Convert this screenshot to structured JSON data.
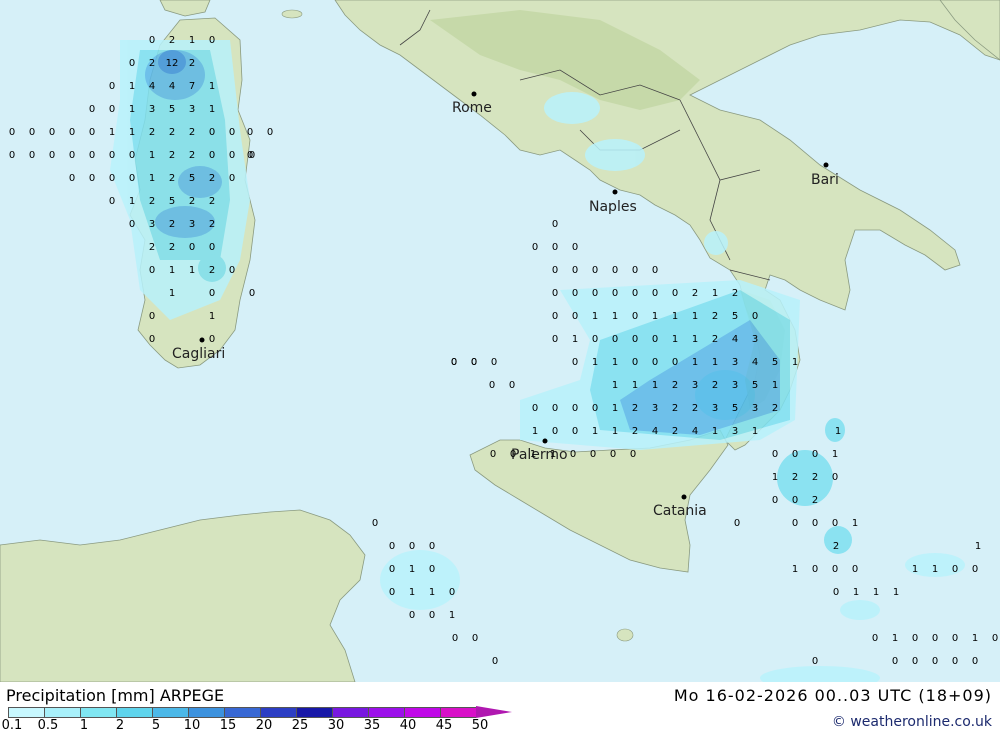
{
  "title": "Precipitation [mm] ARPEGE",
  "datetime": "Mo 16-02-2026 00..03 UTC (18+09)",
  "credit": "© weatheronline.co.uk",
  "legend": {
    "labels": [
      "0.1",
      "0.5",
      "1",
      "2",
      "5",
      "10",
      "15",
      "20",
      "25",
      "30",
      "35",
      "40",
      "45",
      "50"
    ],
    "colors": [
      "#c8f8ff",
      "#a8f0fa",
      "#80e6f2",
      "#5fd4ec",
      "#4cb8e8",
      "#3d92de",
      "#3868d4",
      "#2c3ec4",
      "#1818a8",
      "#7818e0",
      "#9c10ea",
      "#c008e8",
      "#d810c8",
      "#b018b0"
    ]
  },
  "colors": {
    "sea": "#d6f0f8",
    "land": "#d8e6c2",
    "land_hill": "#c3d7a7",
    "precip_light": "#b8f2fb",
    "precip_mid": "#7ee0f0",
    "precip_high": "#5cb8e8"
  },
  "cities": [
    {
      "name": "Rome"
    },
    {
      "name": "Naples"
    },
    {
      "name": "Bari"
    },
    {
      "name": "Cagliari"
    },
    {
      "name": "Palermo"
    },
    {
      "name": "Catania"
    }
  ],
  "values": [
    [
      "0",
      "2",
      "1",
      "0"
    ],
    [
      "0",
      "2",
      "12",
      "2"
    ],
    [
      "0",
      "1",
      "4",
      "4",
      "7",
      "1"
    ],
    [
      "0",
      "0",
      "1",
      "3",
      "5",
      "3",
      "1"
    ],
    [
      "0",
      "0",
      "0",
      "0",
      "0",
      "1",
      "1",
      "2",
      "2",
      "2",
      "0",
      "0"
    ],
    [
      "0",
      "0",
      "0",
      "0",
      "0",
      "0",
      "0",
      "1",
      "2",
      "2",
      "0",
      "0",
      "0"
    ],
    [
      "0",
      "0",
      "0",
      "0",
      "1",
      "2",
      "5",
      "2",
      "0"
    ],
    [
      "0",
      "1",
      "2",
      "5",
      "2",
      "2"
    ],
    [
      "0",
      "3",
      "2",
      "3",
      "2"
    ],
    [
      "2",
      "2",
      "0",
      "0"
    ],
    [
      "0",
      "1",
      "1",
      "2",
      "0"
    ],
    [
      "1",
      "0",
      "0"
    ],
    [
      "0",
      "1"
    ],
    [
      "0",
      "0"
    ],
    [
      "0",
      "0",
      "0"
    ],
    [
      "0",
      "0"
    ],
    [
      "0"
    ],
    [
      "0",
      "0",
      "0"
    ],
    [
      "0",
      "0",
      "0",
      "0"
    ],
    [
      "0",
      "0",
      "0",
      "0",
      "0",
      "0",
      "0",
      "2",
      "1",
      "2"
    ],
    [
      "0",
      "0",
      "1",
      "1",
      "0",
      "1",
      "1",
      "1",
      "2",
      "5",
      "0"
    ],
    [
      "0",
      "1",
      "0",
      "0",
      "0",
      "0",
      "1",
      "1",
      "2",
      "4",
      "3"
    ],
    [
      "0",
      "1",
      "1",
      "0",
      "0",
      "0",
      "1",
      "1",
      "3",
      "4",
      "5",
      "1"
    ],
    [
      "0",
      "0"
    ],
    [
      "1",
      "1",
      "1",
      "2",
      "3",
      "2",
      "3",
      "5",
      "1"
    ],
    [
      "0",
      "0"
    ],
    [
      "0",
      "0",
      "0",
      "0",
      "1",
      "2",
      "3",
      "2",
      "2",
      "3",
      "5",
      "3",
      "2"
    ],
    [
      "1",
      "0",
      "0",
      "1",
      "1",
      "2",
      "4",
      "2",
      "4",
      "1",
      "3",
      "1"
    ],
    [
      "1"
    ],
    [
      "0",
      "0",
      "1",
      "1",
      "0",
      "0",
      "0",
      "0"
    ],
    [
      "0",
      "0",
      "0",
      "1"
    ],
    [
      "1",
      "2",
      "2",
      "0"
    ],
    [
      "0",
      "0",
      "2"
    ],
    [
      "0",
      "0",
      "0",
      "1"
    ],
    [
      "2"
    ],
    [
      "0",
      "0",
      "0"
    ],
    [
      "0",
      "1",
      "0"
    ],
    [
      "0",
      "1",
      "1",
      "0"
    ],
    [
      "0",
      "0",
      "1"
    ],
    [
      "0",
      "0"
    ],
    [
      "0"
    ],
    [
      "1",
      "0",
      "0",
      "0"
    ],
    [
      "1",
      "1",
      "0",
      "0"
    ],
    [
      "1"
    ],
    [
      "0",
      "1",
      "1",
      "1"
    ],
    [
      "0",
      "1",
      "0",
      "0",
      "0",
      "1",
      "0"
    ],
    [
      "0",
      "0",
      "0",
      "0",
      "0"
    ],
    [
      "0"
    ],
    [
      "0"
    ],
    [
      "0"
    ],
    [
      "0",
      "0"
    ],
    [
      "0"
    ]
  ]
}
